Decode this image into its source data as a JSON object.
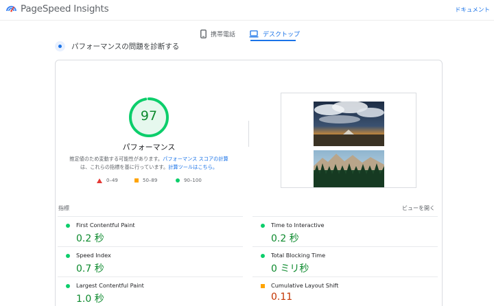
{
  "header": {
    "app_title": "PageSpeed Insights",
    "doc_link": "ドキュメント"
  },
  "tabs": [
    {
      "label": "携帯電話",
      "icon": "phone-icon",
      "selected": false
    },
    {
      "label": "デスクトップ",
      "icon": "laptop-icon",
      "selected": true
    }
  ],
  "diagnose": {
    "title": "パフォーマンスの問題を診断する"
  },
  "score": {
    "value": "97",
    "percent": 97,
    "label": "パフォーマンス",
    "color": "#0cce6b"
  },
  "note": {
    "line1_text": "推定値のため変動する可能性があります。",
    "line1_link": "パフォーマンス スコアの計算",
    "line2_text": "は、これらの指標を基に行っています。",
    "line2_link": "計算ツールはこちら。"
  },
  "legend": [
    {
      "range": "0–49",
      "shape": "triangle",
      "color": "#e53935"
    },
    {
      "range": "50–89",
      "shape": "square",
      "color": "#ffa400"
    },
    {
      "range": "90–100",
      "shape": "circle",
      "color": "#0cce6b"
    }
  ],
  "metrics_section": {
    "label": "指標",
    "view_toggle": "ビューを開く"
  },
  "metrics": [
    {
      "name": "First Contentful Paint",
      "value": "0.2 秒",
      "status": "good"
    },
    {
      "name": "Time to Interactive",
      "value": "0.2 秒",
      "status": "good"
    },
    {
      "name": "Speed Index",
      "value": "0.7 秒",
      "status": "good"
    },
    {
      "name": "Total Blocking Time",
      "value": "0 ミリ秒",
      "status": "good"
    },
    {
      "name": "Largest Contentful Paint",
      "value": "1.0 秒",
      "status": "good"
    },
    {
      "name": "Cumulative Layout Shift",
      "value": "0.11",
      "status": "average"
    }
  ],
  "colors": {
    "accent": "#1a73e8",
    "good": "#0cce6b",
    "good_text": "#0d8a2e",
    "average": "#ffa400",
    "average_text": "#c33300",
    "poor": "#e53935"
  }
}
